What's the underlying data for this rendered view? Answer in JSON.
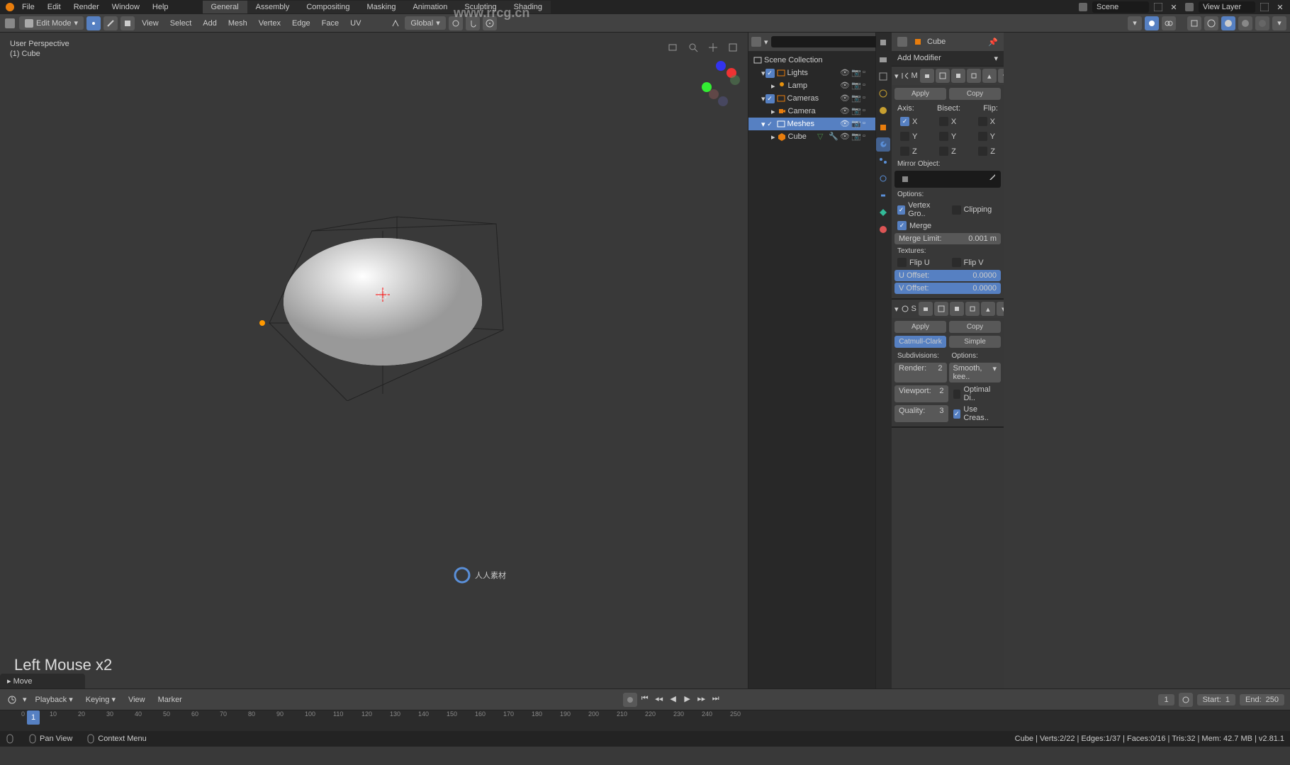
{
  "menubar": {
    "items": [
      "File",
      "Edit",
      "Render",
      "Window",
      "Help"
    ],
    "tabs": [
      "General",
      "Assembly",
      "Compositing",
      "Masking",
      "Animation",
      "Sculpting",
      "Shading"
    ],
    "scene_label": "Scene",
    "viewlayer_label": "View Layer"
  },
  "header": {
    "mode": "Edit Mode",
    "menus": [
      "View",
      "Select",
      "Add",
      "Mesh",
      "Vertex",
      "Edge",
      "Face",
      "UV"
    ],
    "orientation": "Global"
  },
  "viewport": {
    "info1": "User Perspective",
    "info2": "(1) Cube",
    "mouse_hint": "Left Mouse x2",
    "operation": "Move"
  },
  "outliner": {
    "root": "Scene Collection",
    "items": [
      {
        "label": "Lights",
        "indent": 1,
        "icon": "collection"
      },
      {
        "label": "Lamp",
        "indent": 2,
        "icon": "light"
      },
      {
        "label": "Cameras",
        "indent": 1,
        "icon": "collection"
      },
      {
        "label": "Camera",
        "indent": 2,
        "icon": "camera"
      },
      {
        "label": "Meshes",
        "indent": 1,
        "icon": "collection",
        "selected": true
      },
      {
        "label": "Cube",
        "indent": 2,
        "icon": "mesh"
      }
    ]
  },
  "properties": {
    "breadcrumb": "Cube",
    "add_modifier": "Add Modifier",
    "mirror": {
      "short": "M",
      "apply": "Apply",
      "copy": "Copy",
      "axis_label": "Axis:",
      "bisect_label": "Bisect:",
      "flip_label": "Flip:",
      "x": "X",
      "y": "Y",
      "z": "Z",
      "mirror_object": "Mirror Object:",
      "options": "Options:",
      "vertex_group": "Vertex Gro..",
      "clipping": "Clipping",
      "merge": "Merge",
      "merge_limit_label": "Merge Limit:",
      "merge_limit_val": "0.001 m",
      "textures": "Textures:",
      "flip_u": "Flip U",
      "flip_v": "Flip V",
      "u_offset_label": "U Offset:",
      "u_offset_val": "0.0000",
      "v_offset_label": "V Offset:",
      "v_offset_val": "0.0000"
    },
    "subsurf": {
      "short": "S",
      "apply": "Apply",
      "copy": "Copy",
      "catmull": "Catmull-Clark",
      "simple": "Simple",
      "subdivisions": "Subdivisions:",
      "options_label": "Options:",
      "render_label": "Render:",
      "render_val": "2",
      "smooth": "Smooth, kee..",
      "viewport_label": "Viewport:",
      "viewport_val": "2",
      "optimal": "Optimal Di..",
      "quality_label": "Quality:",
      "quality_val": "3",
      "use_creas": "Use Creas.."
    }
  },
  "timeline": {
    "menus": [
      "Playback",
      "Keying",
      "View",
      "Marker"
    ],
    "current_frame": "1",
    "start_label": "Start:",
    "start_val": "1",
    "end_label": "End:",
    "end_val": "250",
    "frames": [
      "0",
      "10",
      "20",
      "30",
      "40",
      "50",
      "60",
      "70",
      "80",
      "90",
      "100",
      "110",
      "120",
      "130",
      "140",
      "150",
      "160",
      "170",
      "180",
      "190",
      "200",
      "210",
      "220",
      "230",
      "240",
      "250"
    ]
  },
  "statusbar": {
    "pan": "Pan View",
    "context": "Context Menu",
    "stats": "Cube | Verts:2/22 | Edges:1/37 | Faces:0/16 | Tris:32 | Mem: 42.7 MB | v2.81.1"
  },
  "watermark": {
    "url": "www.rrcg.cn",
    "text": "人人素材"
  }
}
